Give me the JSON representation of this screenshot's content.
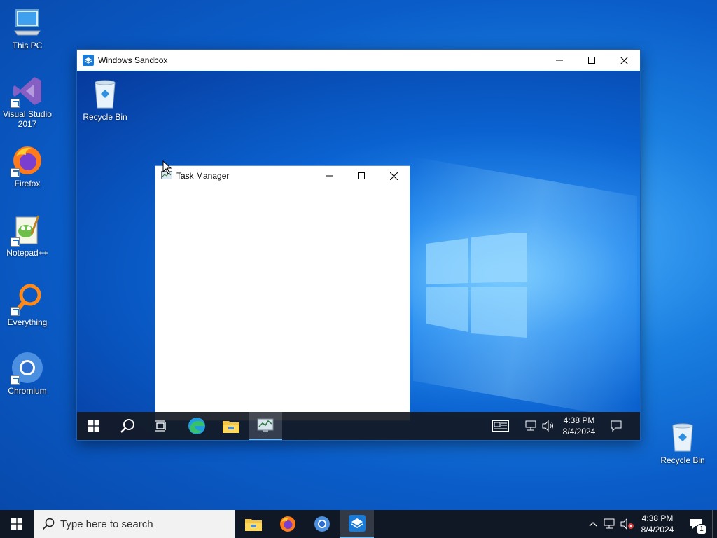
{
  "desktop": {
    "icons": [
      {
        "label": "This PC"
      },
      {
        "label": "Visual Studio 2017"
      },
      {
        "label": "Firefox"
      },
      {
        "label": "Notepad++"
      },
      {
        "label": "Everything"
      },
      {
        "label": "Chromium"
      },
      {
        "label": "Recycle Bin"
      }
    ]
  },
  "sandbox": {
    "title": "Windows Sandbox",
    "desktop_icon": "Recycle Bin",
    "task_manager": {
      "title": "Task Manager"
    },
    "taskbar": {
      "time": "4:38 PM",
      "date": "8/4/2024"
    }
  },
  "taskbar": {
    "search_placeholder": "Type here to search",
    "time": "4:38 PM",
    "date": "8/4/2024",
    "notification_count": "1"
  },
  "colors": {
    "accent": "#0a62d0",
    "taskbar": "#101826",
    "window_border": "#1a5fb4"
  }
}
